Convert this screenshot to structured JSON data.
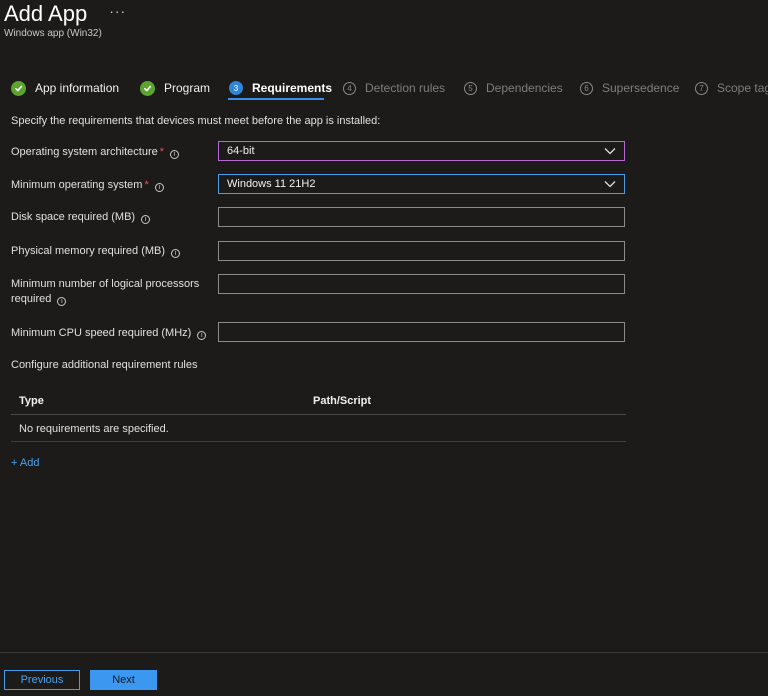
{
  "header": {
    "title": "Add App",
    "more": "···",
    "subtitle": "Windows app (Win32)"
  },
  "steps": [
    {
      "label": "App information",
      "state": "done"
    },
    {
      "label": "Program",
      "state": "done"
    },
    {
      "label": "Requirements",
      "state": "active",
      "number": "3"
    },
    {
      "label": "Detection rules",
      "state": "future",
      "number": "4"
    },
    {
      "label": "Dependencies",
      "state": "future",
      "number": "5"
    },
    {
      "label": "Supersedence",
      "state": "future",
      "number": "6"
    },
    {
      "label": "Scope tags",
      "state": "future",
      "number": "7"
    }
  ],
  "intro": "Specify the requirements that devices must meet before the app is installed:",
  "form": {
    "os_arch": {
      "label": "Operating system architecture",
      "required": "*",
      "value": "64-bit"
    },
    "min_os": {
      "label": "Minimum operating system",
      "required": "*",
      "value": "Windows 11 21H2"
    },
    "disk": {
      "label": "Disk space required (MB)",
      "value": ""
    },
    "memory": {
      "label": "Physical memory required (MB)",
      "value": ""
    },
    "processors": {
      "label_line1": "Minimum number of logical processors",
      "label_line2": "required",
      "value": ""
    },
    "cpu": {
      "label": "Minimum CPU speed required (MHz)",
      "value": ""
    }
  },
  "config_label": "Configure additional requirement rules",
  "table": {
    "columns": [
      "Type",
      "Path/Script"
    ],
    "empty": "No requirements are specified."
  },
  "add_label": "+ Add",
  "footer": {
    "previous": "Previous",
    "next": "Next"
  },
  "colors": {
    "accent": "#3b97f0",
    "done": "#5ba52e",
    "required": "#e8514e"
  }
}
